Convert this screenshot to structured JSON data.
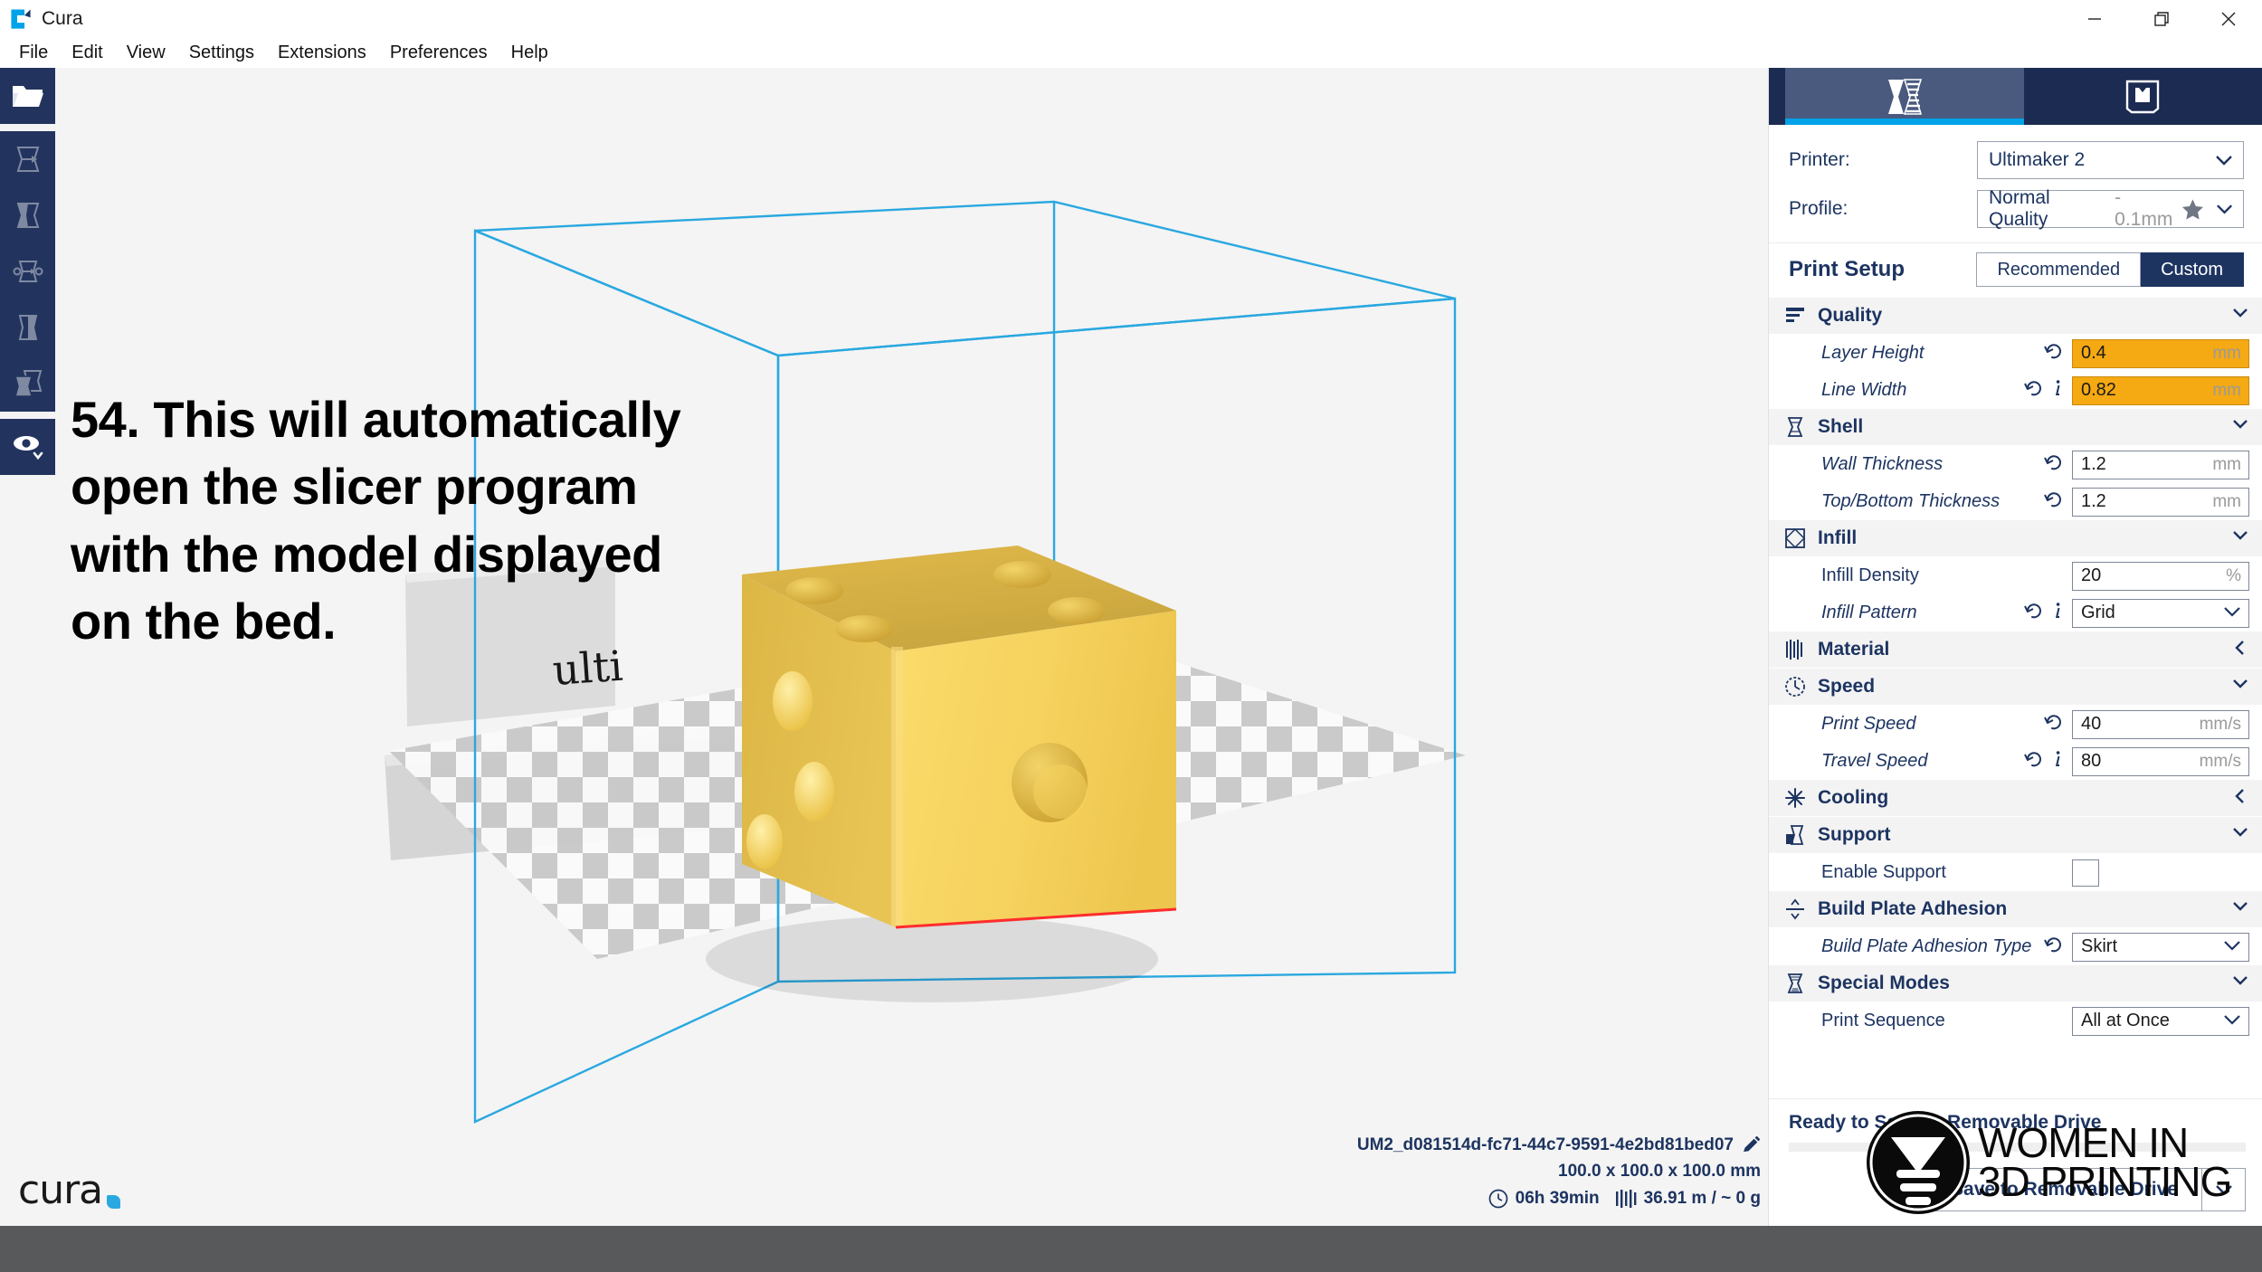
{
  "window": {
    "app_title": "Cura",
    "app_icon": "cura-logo-icon",
    "controls": {
      "minimize": "minimize-icon",
      "restore": "restore-icon",
      "close": "close-icon"
    }
  },
  "menubar": {
    "items": [
      "File",
      "Edit",
      "View",
      "Settings",
      "Extensions",
      "Preferences",
      "Help"
    ]
  },
  "toolbar": {
    "items": [
      {
        "name": "open-file-button",
        "icon": "folder-open-icon",
        "enabled": true
      },
      {
        "name": "move-tool-button",
        "icon": "move-model-icon",
        "enabled": false
      },
      {
        "name": "scale-tool-button",
        "icon": "scale-model-icon",
        "enabled": false
      },
      {
        "name": "rotate-tool-button",
        "icon": "rotate-model-icon",
        "enabled": false
      },
      {
        "name": "mirror-tool-button",
        "icon": "mirror-model-icon",
        "enabled": false
      },
      {
        "name": "per-model-settings-button",
        "icon": "per-model-settings-icon",
        "enabled": false
      },
      {
        "name": "view-mode-button",
        "icon": "eye-icon",
        "enabled": true
      }
    ]
  },
  "overlay": {
    "instruction": "54. This will automatically open the slicer program with the model displayed on the bed."
  },
  "viewport": {
    "model_name": "dice",
    "model_color": "#f2cd53",
    "build_plate_brand": "Ultimaker",
    "bounding_box_color": "#2aa8e0"
  },
  "job_info": {
    "file_name": "UM2_d081514d-fc71-44c7-9591-4e2bd81bed07",
    "edit_icon": "pencil-icon",
    "dimensions": "100.0 x 100.0 x 100.0 mm",
    "time_icon": "clock-icon",
    "print_time": "06h 39min",
    "material_icon": "filament-icon",
    "material_amount": "36.91 m / ~ 0 g"
  },
  "brand": {
    "logo_word": "cura",
    "logo_dot_color": "#2aa8e0"
  },
  "sidebar": {
    "tabs": [
      {
        "name": "tab-prepare",
        "icon": "solid-view-icon",
        "active": true
      },
      {
        "name": "tab-preview",
        "icon": "layer-view-icon",
        "active": false
      }
    ],
    "printer": {
      "label": "Printer:",
      "value": "Ultimaker 2"
    },
    "profile": {
      "label": "Profile:",
      "value": "Normal Quality",
      "detail": "- 0.1mm",
      "star_icon": "star-icon"
    },
    "print_setup": {
      "title": "Print Setup",
      "modes": [
        {
          "label": "Recommended",
          "active": false
        },
        {
          "label": "Custom",
          "active": true
        }
      ]
    },
    "categories": [
      {
        "label": "Quality",
        "icon": "quality-icon",
        "expanded": true,
        "chevron": "down",
        "settings": [
          {
            "label": "Layer Height",
            "italic": true,
            "revert": true,
            "info": false,
            "control": "input",
            "value": "0.4",
            "unit": "mm",
            "highlight": true
          },
          {
            "label": "Line Width",
            "italic": true,
            "revert": true,
            "info": true,
            "control": "input",
            "value": "0.82",
            "unit": "mm",
            "highlight": true
          }
        ]
      },
      {
        "label": "Shell",
        "icon": "shell-icon",
        "expanded": true,
        "chevron": "down",
        "settings": [
          {
            "label": "Wall Thickness",
            "italic": true,
            "revert": true,
            "info": false,
            "control": "input",
            "value": "1.2",
            "unit": "mm",
            "highlight": false
          },
          {
            "label": "Top/Bottom Thickness",
            "italic": true,
            "revert": true,
            "info": false,
            "control": "input",
            "value": "1.2",
            "unit": "mm",
            "highlight": false
          }
        ]
      },
      {
        "label": "Infill",
        "icon": "infill-icon",
        "expanded": true,
        "chevron": "down",
        "settings": [
          {
            "label": "Infill Density",
            "italic": false,
            "revert": false,
            "info": false,
            "control": "input",
            "value": "20",
            "unit": "%",
            "highlight": false
          },
          {
            "label": "Infill Pattern",
            "italic": true,
            "revert": true,
            "info": true,
            "control": "select",
            "value": "Grid",
            "unit": "",
            "highlight": false
          }
        ]
      },
      {
        "label": "Material",
        "icon": "material-icon",
        "expanded": false,
        "chevron": "left",
        "settings": []
      },
      {
        "label": "Speed",
        "icon": "speed-icon",
        "expanded": true,
        "chevron": "down",
        "settings": [
          {
            "label": "Print Speed",
            "italic": true,
            "revert": true,
            "info": false,
            "control": "input",
            "value": "40",
            "unit": "mm/s",
            "highlight": false
          },
          {
            "label": "Travel Speed",
            "italic": true,
            "revert": true,
            "info": true,
            "control": "input",
            "value": "80",
            "unit": "mm/s",
            "highlight": false
          }
        ]
      },
      {
        "label": "Cooling",
        "icon": "cooling-icon",
        "expanded": false,
        "chevron": "left",
        "settings": []
      },
      {
        "label": "Support",
        "icon": "support-icon",
        "expanded": true,
        "chevron": "down",
        "settings": [
          {
            "label": "Enable Support",
            "italic": false,
            "revert": false,
            "info": false,
            "control": "checkbox",
            "value": "",
            "unit": "",
            "checked": false,
            "highlight": false
          }
        ]
      },
      {
        "label": "Build Plate Adhesion",
        "icon": "adhesion-icon",
        "expanded": true,
        "chevron": "down",
        "settings": [
          {
            "label": "Build Plate Adhesion Type",
            "italic": true,
            "revert": true,
            "info": false,
            "control": "select",
            "value": "Skirt",
            "unit": "",
            "highlight": false
          }
        ]
      },
      {
        "label": "Special Modes",
        "icon": "special-modes-icon",
        "expanded": true,
        "chevron": "down",
        "settings": [
          {
            "label": "Print Sequence",
            "italic": false,
            "revert": false,
            "info": false,
            "control": "select",
            "value": "All at Once",
            "unit": "",
            "highlight": false
          }
        ]
      }
    ],
    "footer": {
      "status": "Ready to Save to Removable Drive",
      "save_label": "Save to Removable Drive",
      "dropdown_icon": "chevron-down-icon"
    }
  },
  "watermark": {
    "line1": "WOMEN IN",
    "line2": "3D PRINTING",
    "badge_icon": "women-in-3d-printing-badge"
  },
  "colors": {
    "navy": "#1d3461",
    "panel_navy": "#1b2b52",
    "accent_blue": "#00a2e8",
    "highlight_orange": "#f5a912",
    "model_yellow": "#f2cd53"
  }
}
